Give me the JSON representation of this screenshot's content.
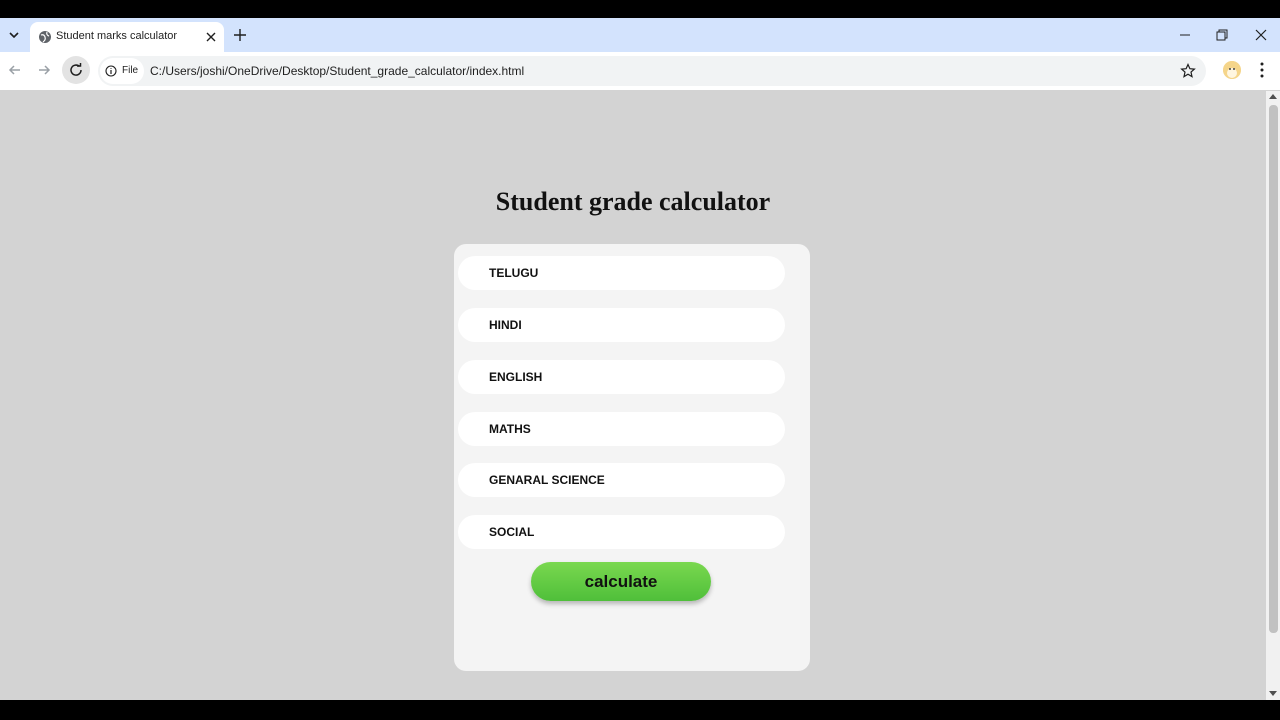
{
  "browser": {
    "tab_title": "Student marks calculator",
    "site_chip_label": "File",
    "url": "C:/Users/joshi/OneDrive/Desktop/Student_grade_calculator/index.html"
  },
  "page": {
    "title": "Student grade calculator",
    "fields": [
      {
        "placeholder": "TELUGU"
      },
      {
        "placeholder": "HINDI"
      },
      {
        "placeholder": "ENGLISH"
      },
      {
        "placeholder": "MATHS"
      },
      {
        "placeholder": "GENARAL SCIENCE"
      },
      {
        "placeholder": "SOCIAL"
      }
    ],
    "calculate_label": "calculate"
  },
  "colors": {
    "page_background": "#d3d3d3",
    "card_background": "#f4f4f4",
    "button_green": "#5ecb43",
    "tabstrip": "#d3e3fd"
  },
  "icons": [
    "tab-search-icon",
    "globe-icon",
    "close-icon",
    "plus-icon",
    "minimize-icon",
    "restore-icon",
    "back-arrow-icon",
    "forward-arrow-icon",
    "reload-icon",
    "info-icon",
    "star-icon",
    "profile-avatar-icon",
    "more-menu-icon"
  ]
}
